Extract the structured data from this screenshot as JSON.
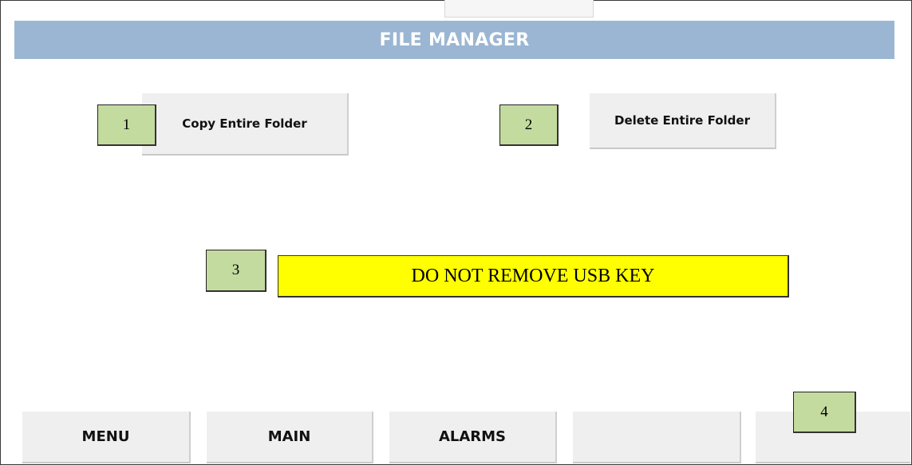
{
  "header": {
    "title": "FILE MANAGER"
  },
  "actions": {
    "copy_label": "Copy Entire Folder",
    "delete_label": "Delete Entire Folder"
  },
  "status": {
    "warning_text": "DO NOT REMOVE USB KEY",
    "warning_color": "#ffff00"
  },
  "nav": {
    "menu_label": "MENU",
    "main_label": "MAIN",
    "alarms_label": "ALARMS",
    "blank1_label": "",
    "blank2_label": ""
  },
  "callouts": {
    "c1": "1",
    "c2": "2",
    "c3": "3",
    "c4": "4",
    "color": "#c4dba0"
  },
  "colors": {
    "title_bar": "#9bb6d3",
    "button_bg": "#efefef"
  }
}
